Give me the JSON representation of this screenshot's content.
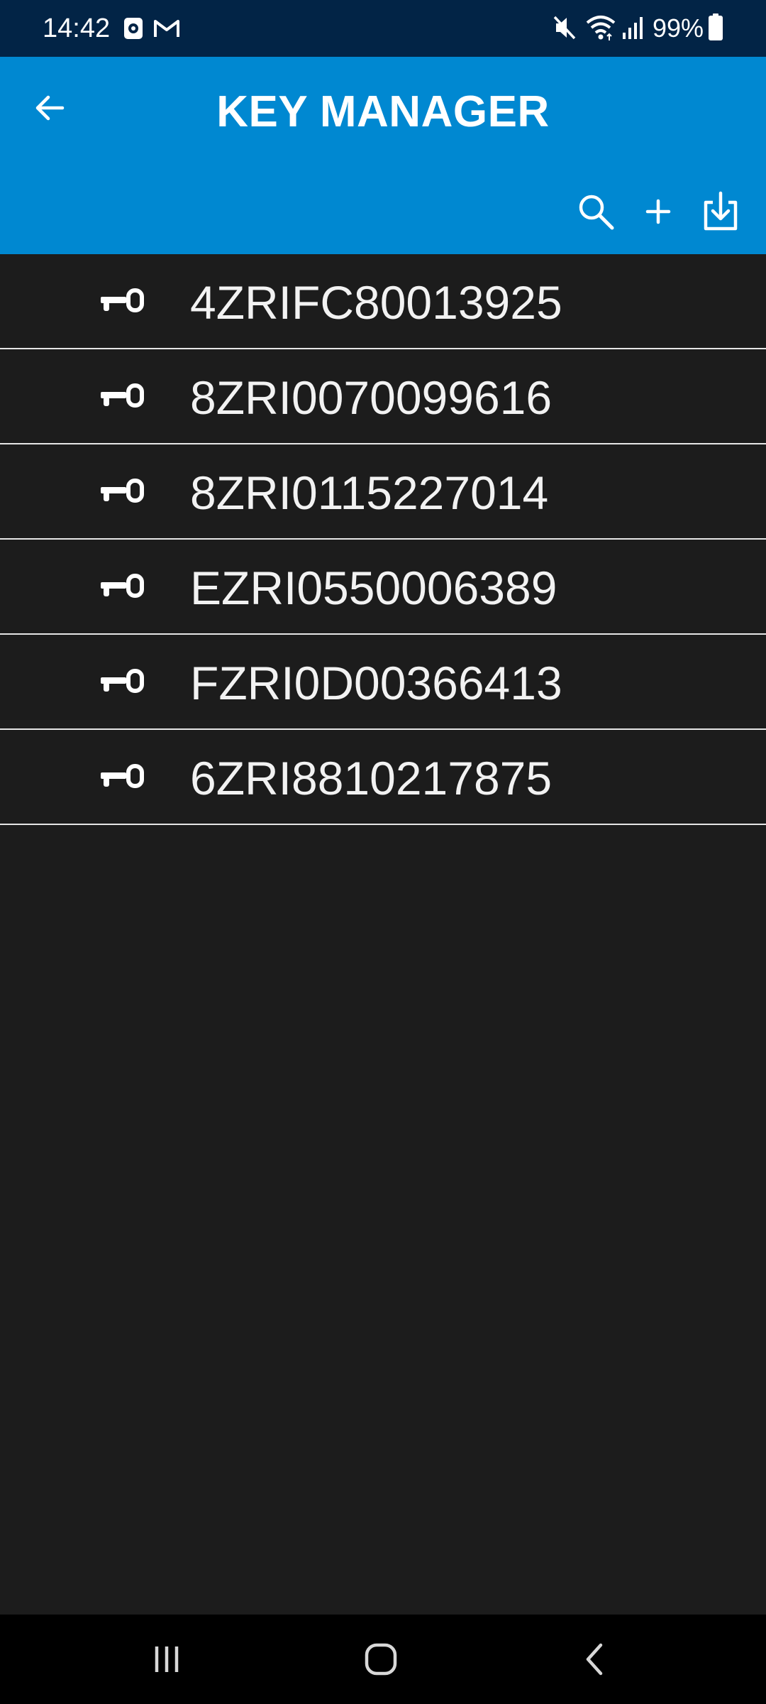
{
  "status_bar": {
    "time": "14:42",
    "battery": "99%",
    "icons": [
      "screen-record-icon",
      "gmail-icon",
      "mute-icon",
      "wifi-icon",
      "signal-icon",
      "battery-icon"
    ]
  },
  "app_bar": {
    "title": "KEY MANAGER",
    "background_color": "#0088d1",
    "actions": [
      "search-icon",
      "add-icon",
      "import-icon"
    ]
  },
  "keys": [
    {
      "label": "4ZRIFC80013925"
    },
    {
      "label": "8ZRI0070099616"
    },
    {
      "label": "8ZRI0115227014"
    },
    {
      "label": "EZRI0550006389"
    },
    {
      "label": "FZRI0D00366413"
    },
    {
      "label": "6ZRI8810217875"
    }
  ],
  "nav_bar": {
    "buttons": [
      "recents-icon",
      "home-icon",
      "back-icon"
    ]
  },
  "colors": {
    "status_bar": "#022446",
    "list_background": "#1c1c1c",
    "divider": "#e6e6e6",
    "text": "#f2f2f2"
  }
}
